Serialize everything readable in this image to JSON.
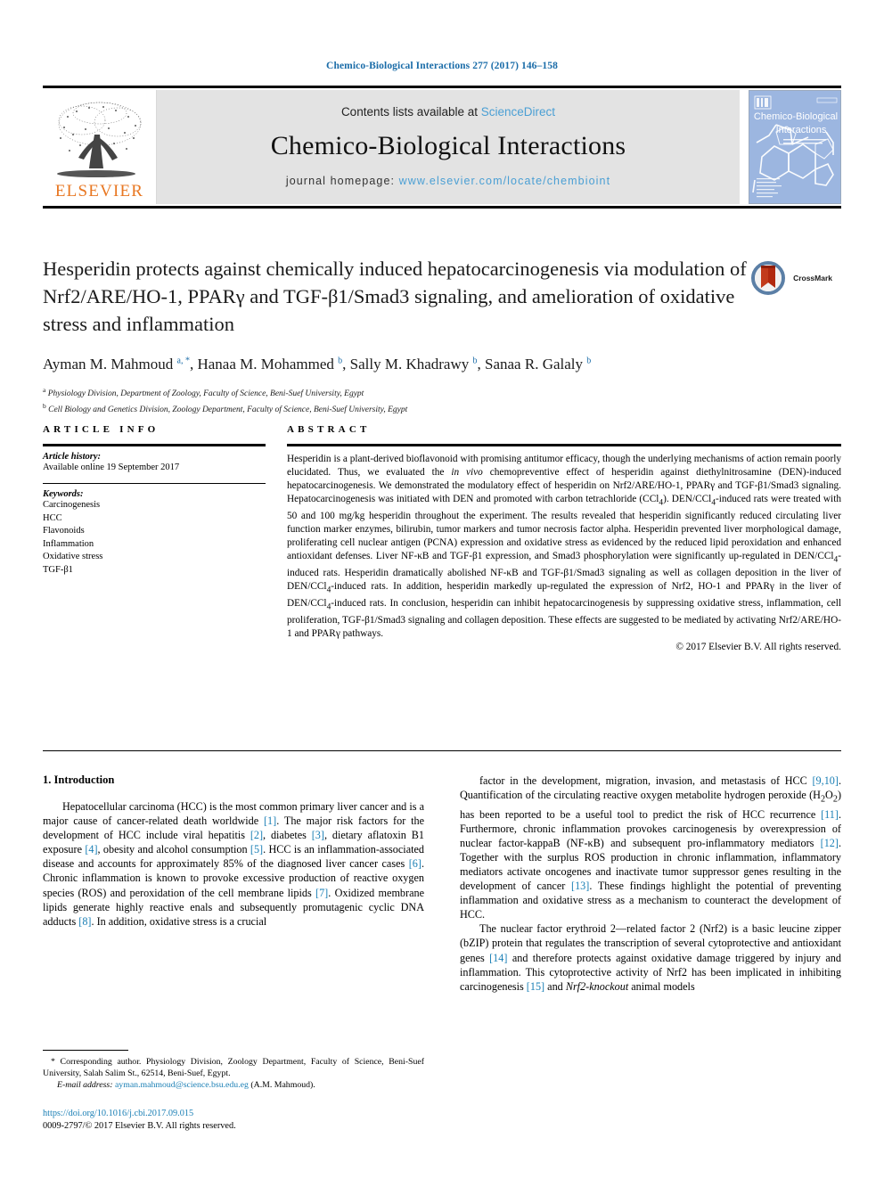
{
  "running_head": "Chemico-Biological Interactions 277 (2017) 146–158",
  "masthead": {
    "contents_prefix": "Contents lists available at ",
    "sciencedirect": "ScienceDirect",
    "journal_title": "Chemico-Biological Interactions",
    "homepage_prefix": "journal homepage: ",
    "homepage_url": "www.elsevier.com/locate/chembioint",
    "publisher_wordmark": "ELSEVIER",
    "cover_title_line1": "Chemico-Biological",
    "cover_title_line2": "Interactions",
    "accent_link_color": "#4a9fd4",
    "elsevier_orange": "#E87722"
  },
  "article": {
    "title": "Hesperidin protects against chemically induced hepatocarcinogenesis via modulation of Nrf2/ARE/HO-1, PPARγ and TGF-β1/Smad3 signaling, and amelioration of oxidative stress and inflammation",
    "crossmark_label": "CrossMark",
    "authors_html": "Ayman M. Mahmoud <sup>a, *</sup>, Hanaa M. Mohammed <sup>b</sup>, Sally M. Khadrawy <sup>b</sup>, Sanaa R. Galaly <sup>b</sup>",
    "affiliation_a": "Physiology Division, Department of Zoology, Faculty of Science, Beni-Suef University, Egypt",
    "affiliation_b": "Cell Biology and Genetics Division, Zoology Department, Faculty of Science, Beni-Suef University, Egypt"
  },
  "article_info": {
    "heading": "ARTICLE INFO",
    "history_label": "Article history:",
    "history_value": "Available online 19 September 2017",
    "keywords_label": "Keywords:",
    "keywords": [
      "Carcinogenesis",
      "HCC",
      "Flavonoids",
      "Inflammation",
      "Oxidative stress",
      "TGF-β1"
    ]
  },
  "abstract": {
    "heading": "ABSTRACT",
    "text": "Hesperidin is a plant-derived bioflavonoid with promising antitumor efficacy, though the underlying mechanisms of action remain poorly elucidated. Thus, we evaluated the in vivo chemopreventive effect of hesperidin against diethylnitrosamine (DEN)-induced hepatocarcinogenesis. We demonstrated the modulatory effect of hesperidin on Nrf2/ARE/HO-1, PPARγ and TGF-β1/Smad3 signaling. Hepatocarcinogenesis was initiated with DEN and promoted with carbon tetrachloride (CCl4). DEN/CCl4-induced rats were treated with 50 and 100 mg/kg hesperidin throughout the experiment. The results revealed that hesperidin significantly reduced circulating liver function marker enzymes, bilirubin, tumor markers and tumor necrosis factor alpha. Hesperidin prevented liver morphological damage, proliferating cell nuclear antigen (PCNA) expression and oxidative stress as evidenced by the reduced lipid peroxidation and enhanced antioxidant defenses. Liver NF-κB and TGF-β1 expression, and Smad3 phosphorylation were significantly up-regulated in DEN/CCl4-induced rats. Hesperidin dramatically abolished NF-κB and TGF-β1/Smad3 signaling as well as collagen deposition in the liver of DEN/CCl4-induced rats. In addition, hesperidin markedly up-regulated the expression of Nrf2, HO-1 and PPARγ in the liver of DEN/CCl4-induced rats. In conclusion, hesperidin can inhibit hepatocarcinogenesis by suppressing oxidative stress, inflammation, cell proliferation, TGF-β1/Smad3 signaling and collagen deposition. These effects are suggested to be mediated by activating Nrf2/ARE/HO-1 and PPARγ pathways.",
    "copyright": "© 2017 Elsevier B.V. All rights reserved."
  },
  "body": {
    "section_number_title": "1. Introduction",
    "left_paragraph_1": "Hepatocellular carcinoma (HCC) is the most common primary liver cancer and is a major cause of cancer-related death worldwide [1]. The major risk factors for the development of HCC include viral hepatitis [2], diabetes [3], dietary aflatoxin B1 exposure [4], obesity and alcohol consumption [5]. HCC is an inflammation-associated disease and accounts for approximately 85% of the diagnosed liver cancer cases [6]. Chronic inflammation is known to provoke excessive production of reactive oxygen species (ROS) and peroxidation of the cell membrane lipids [7]. Oxidized membrane lipids generate highly reactive enals and subsequently promutagenic cyclic DNA adducts [8]. In addition, oxidative stress is a crucial",
    "right_paragraph_1": "factor in the development, migration, invasion, and metastasis of HCC [9,10]. Quantification of the circulating reactive oxygen metabolite hydrogen peroxide (H2O2) has been reported to be a useful tool to predict the risk of HCC recurrence [11]. Furthermore, chronic inflammation provokes carcinogenesis by overexpression of nuclear factor-kappaB (NF-κB) and subsequent pro-inflammatory mediators [12]. Together with the surplus ROS production in chronic inflammation, inflammatory mediators activate oncogenes and inactivate tumor suppressor genes resulting in the development of cancer [13]. These findings highlight the potential of preventing inflammation and oxidative stress as a mechanism to counteract the development of HCC.",
    "right_paragraph_2": "The nuclear factor erythroid 2—related factor 2 (Nrf2) is a basic leucine zipper (bZIP) protein that regulates the transcription of several cytoprotective and antioxidant genes [14] and therefore protects against oxidative damage triggered by injury and inflammation. This cytoprotective activity of Nrf2 has been implicated in inhibiting carcinogenesis [15] and Nrf2-knockout animal models"
  },
  "footnote": {
    "corresponding": "* Corresponding author. Physiology Division, Zoology Department, Faculty of Science, Beni-Suef University, Salah Salim St., 62514, Beni-Suef, Egypt.",
    "email_label": "E-mail address:",
    "email": "ayman.mahmoud@science.bsu.edu.eg",
    "email_suffix": " (A.M. Mahmoud)."
  },
  "colophon": {
    "doi": "https://doi.org/10.1016/j.cbi.2017.09.015",
    "issn": "0009-2797/© 2017 Elsevier B.V. All rights reserved."
  }
}
